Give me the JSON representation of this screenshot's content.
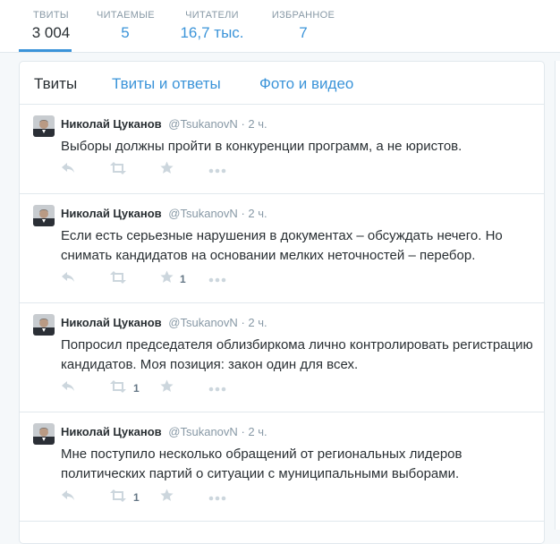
{
  "stats": [
    {
      "label": "ТВИТЫ",
      "value": "3 004"
    },
    {
      "label": "ЧИТАЕМЫЕ",
      "value": "5"
    },
    {
      "label": "ЧИТАТЕЛИ",
      "value": "16,7 тыс."
    },
    {
      "label": "ИЗБРАННОЕ",
      "value": "7"
    }
  ],
  "tabs": [
    "Твиты",
    "Твиты и ответы",
    "Фото и видео"
  ],
  "tweets": [
    {
      "name": "Николай Цуканов",
      "handle": "@TsukanovN",
      "time": "· 2 ч.",
      "text": "Выборы должны пройти в конкуренции программ, а не юристов.",
      "retweets": "",
      "favorites": ""
    },
    {
      "name": "Николай Цуканов",
      "handle": "@TsukanovN",
      "time": "· 2 ч.",
      "text": "Если есть серьезные нарушения в документах – обсуждать нечего. Но снимать кандидатов на основании мелких неточностей – перебор.",
      "retweets": "",
      "favorites": "1"
    },
    {
      "name": "Николай Цуканов",
      "handle": "@TsukanovN",
      "time": "· 2 ч.",
      "text": "Попросил председателя облизбиркома лично контролировать регистрацию кандидатов. Моя позиция: закон один для всех.",
      "retweets": "1",
      "favorites": ""
    },
    {
      "name": "Николай Цуканов",
      "handle": "@TsukanovN",
      "time": "· 2 ч.",
      "text": "Мне поступило несколько обращений от региональных лидеров политических партий о ситуации с муниципальными выборами.",
      "retweets": "1",
      "favorites": ""
    }
  ],
  "icons": {
    "reply": "reply-icon",
    "retweet": "retweet-icon",
    "favorite": "star-icon",
    "more": "more-icon"
  },
  "colors": {
    "accent": "#3b94d9",
    "text": "#292f33",
    "muted": "#8899a6",
    "icon": "#ccd6dd"
  }
}
